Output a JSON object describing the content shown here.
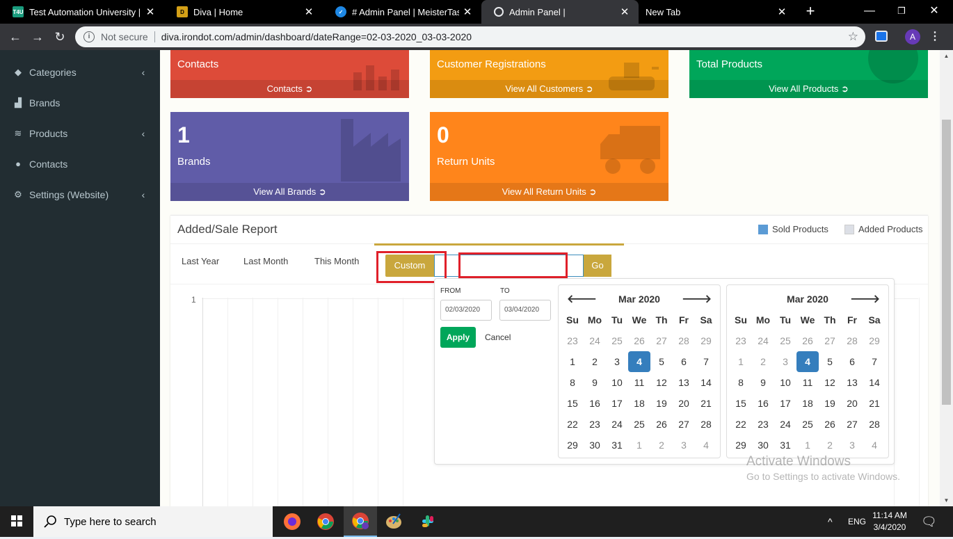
{
  "browser": {
    "tabs": [
      {
        "title": "Test Automation University | Ap",
        "favicon": "T4U",
        "color": "#1a9c7e"
      },
      {
        "title": "Diva | Home",
        "favicon": "D",
        "color": "#d4a017"
      },
      {
        "title": "# Admin Panel | MeisterTask",
        "favicon": "✓",
        "color": "#1e88e5"
      },
      {
        "title": "Admin Panel |",
        "favicon": "🌐",
        "color": "#35363a"
      },
      {
        "title": "New Tab",
        "favicon": "",
        "color": "#000"
      }
    ],
    "not_secure": "Not secure",
    "url": "diva.irondot.com/admin/dashboard/dateRange=02-03-2020_03-03-2020",
    "profile_initial": "A"
  },
  "sidebar": {
    "items": [
      {
        "label": "Categories",
        "icon": "tags-icon",
        "has_children": true
      },
      {
        "label": "Brands",
        "icon": "bar-chart-icon",
        "has_children": false
      },
      {
        "label": "Products",
        "icon": "database-icon",
        "has_children": true
      },
      {
        "label": "Contacts",
        "icon": "users-icon",
        "has_children": false
      },
      {
        "label": "Settings (Website)",
        "icon": "gears-icon",
        "has_children": true
      }
    ]
  },
  "boxes": {
    "contacts": {
      "name": "Contacts",
      "link": "Contacts",
      "color": "#dd4b39"
    },
    "customers": {
      "name": "Customer Registrations",
      "link": "View All Customers",
      "color": "#f39c12"
    },
    "products": {
      "name": "Total Products",
      "link": "View All Products",
      "color": "#00a65a"
    },
    "brands": {
      "num": "1",
      "name": "Brands",
      "link": "View All Brands",
      "color": "#605ca8"
    },
    "returns": {
      "num": "0",
      "name": "Return Units",
      "link": "View All Return Units",
      "color": "#ff851b"
    }
  },
  "report": {
    "title": "Added/Sale Report",
    "legend": [
      {
        "label": "Sold Products",
        "color": "#5b9bd5"
      },
      {
        "label": "Added Products",
        "color": "#dcdfe6"
      }
    ],
    "ranges": [
      "Last Year",
      "Last Month",
      "This Month"
    ],
    "custom_label": "Custom",
    "go_label": "Go",
    "y_tick": "1"
  },
  "picker": {
    "from_label": "FROM",
    "to_label": "TO",
    "from_value": "02/03/2020",
    "to_value": "03/04/2020",
    "apply_label": "Apply",
    "cancel_label": "Cancel",
    "weekdays": [
      "Su",
      "Mo",
      "Tu",
      "We",
      "Th",
      "Fr",
      "Sa"
    ],
    "left": {
      "month": "Mar 2020",
      "weeks": [
        [
          [
            "23",
            "off"
          ],
          [
            "24",
            "off"
          ],
          [
            "25",
            "off"
          ],
          [
            "26",
            "off"
          ],
          [
            "27",
            "off"
          ],
          [
            "28",
            "off"
          ],
          [
            "29",
            "off"
          ]
        ],
        [
          [
            "1",
            ""
          ],
          [
            "2",
            ""
          ],
          [
            "3",
            ""
          ],
          [
            "4",
            "sel"
          ],
          [
            "5",
            ""
          ],
          [
            "6",
            ""
          ],
          [
            "7",
            ""
          ]
        ],
        [
          [
            "8",
            ""
          ],
          [
            "9",
            ""
          ],
          [
            "10",
            ""
          ],
          [
            "11",
            ""
          ],
          [
            "12",
            ""
          ],
          [
            "13",
            ""
          ],
          [
            "14",
            ""
          ]
        ],
        [
          [
            "15",
            ""
          ],
          [
            "16",
            ""
          ],
          [
            "17",
            ""
          ],
          [
            "18",
            ""
          ],
          [
            "19",
            ""
          ],
          [
            "20",
            ""
          ],
          [
            "21",
            ""
          ]
        ],
        [
          [
            "22",
            ""
          ],
          [
            "23",
            ""
          ],
          [
            "24",
            ""
          ],
          [
            "25",
            ""
          ],
          [
            "26",
            ""
          ],
          [
            "27",
            ""
          ],
          [
            "28",
            ""
          ]
        ],
        [
          [
            "29",
            ""
          ],
          [
            "30",
            ""
          ],
          [
            "31",
            ""
          ],
          [
            "1",
            "off"
          ],
          [
            "2",
            "off"
          ],
          [
            "3",
            "off"
          ],
          [
            "4",
            "off"
          ]
        ]
      ]
    },
    "right": {
      "month": "Mar 2020",
      "weeks": [
        [
          [
            "23",
            "off"
          ],
          [
            "24",
            "off"
          ],
          [
            "25",
            "off"
          ],
          [
            "26",
            "off"
          ],
          [
            "27",
            "off"
          ],
          [
            "28",
            "off"
          ],
          [
            "29",
            "off"
          ]
        ],
        [
          [
            "1",
            "off"
          ],
          [
            "2",
            "off"
          ],
          [
            "3",
            "off"
          ],
          [
            "4",
            "sel"
          ],
          [
            "5",
            ""
          ],
          [
            "6",
            ""
          ],
          [
            "7",
            ""
          ]
        ],
        [
          [
            "8",
            ""
          ],
          [
            "9",
            ""
          ],
          [
            "10",
            ""
          ],
          [
            "11",
            ""
          ],
          [
            "12",
            ""
          ],
          [
            "13",
            ""
          ],
          [
            "14",
            ""
          ]
        ],
        [
          [
            "15",
            ""
          ],
          [
            "16",
            ""
          ],
          [
            "17",
            ""
          ],
          [
            "18",
            ""
          ],
          [
            "19",
            ""
          ],
          [
            "20",
            ""
          ],
          [
            "21",
            ""
          ]
        ],
        [
          [
            "22",
            ""
          ],
          [
            "23",
            ""
          ],
          [
            "24",
            ""
          ],
          [
            "25",
            ""
          ],
          [
            "26",
            ""
          ],
          [
            "27",
            ""
          ],
          [
            "28",
            ""
          ]
        ],
        [
          [
            "29",
            ""
          ],
          [
            "30",
            ""
          ],
          [
            "31",
            ""
          ],
          [
            "1",
            "off"
          ],
          [
            "2",
            "off"
          ],
          [
            "3",
            "off"
          ],
          [
            "4",
            "off"
          ]
        ]
      ]
    }
  },
  "watermark": {
    "line1": "Activate Windows",
    "line2": "Go to Settings to activate Windows."
  },
  "taskbar": {
    "search_placeholder": "Type here to search",
    "lang": "ENG",
    "time": "11:14 AM",
    "date": "3/4/2020"
  }
}
